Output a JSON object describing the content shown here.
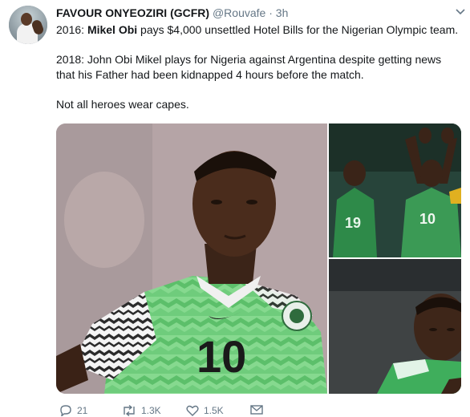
{
  "tweet": {
    "author_name": "FAVOUR ONYEOZIRI (GCFR)",
    "author_handle": "@Rouvafe",
    "separator": "·",
    "timestamp": "3h",
    "line1_prefix": "2016: ",
    "line1_bold": "Mikel Obi",
    "line1_rest": " pays $4,000 unsettled Hotel Bills for the Nigerian Olympic team.",
    "line2a": "2018: John Obi Mikel plays for Nigeria against Argentina despite getting news",
    "line2b": "that his Father had been kidnapped 4 hours before the match.",
    "line3": "Not all heroes wear capes."
  },
  "jersey_number": "10",
  "actions": {
    "replies": "21",
    "retweets": "1.3K",
    "likes": "1.5K"
  },
  "colors": {
    "text": "#14171a",
    "muted": "#657786",
    "jersey_green": "#7ed38a",
    "jersey_dark": "#1b6b3a"
  },
  "icons": {
    "more": "chevron-down-icon",
    "reply": "reply-icon",
    "retweet": "retweet-icon",
    "like": "heart-icon",
    "dm": "envelope-icon"
  }
}
